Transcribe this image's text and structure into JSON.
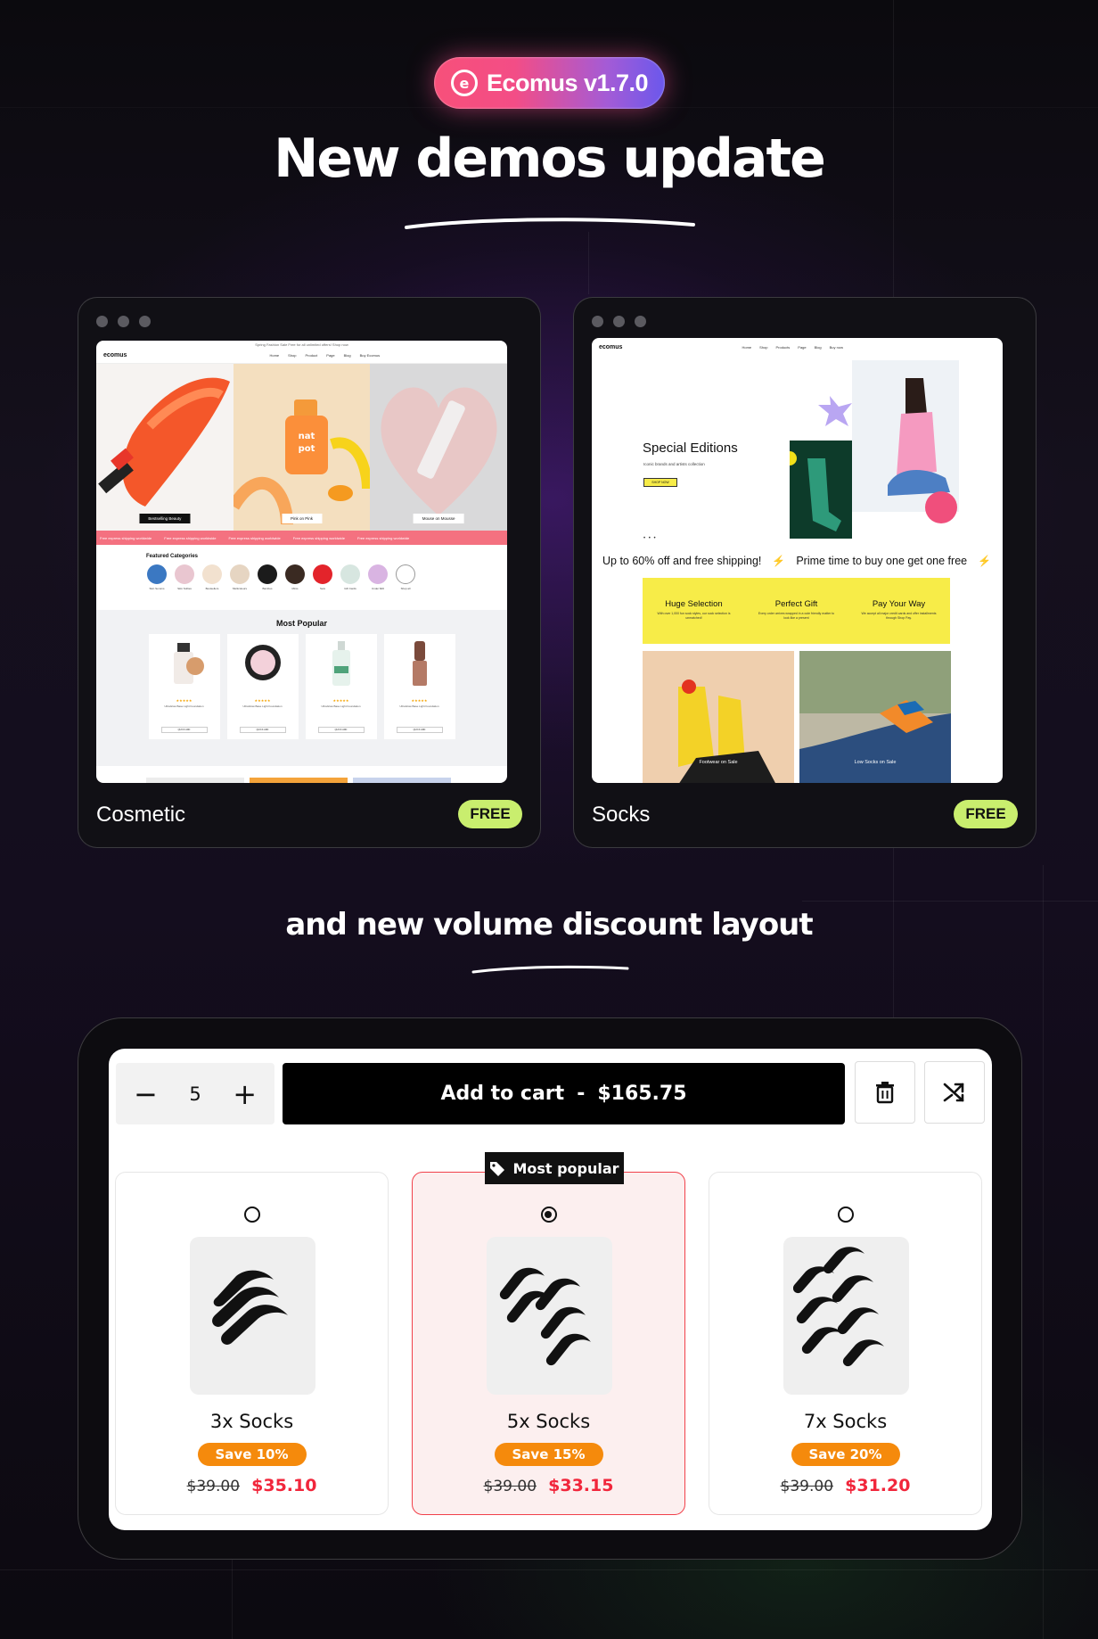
{
  "header": {
    "badge_label": "Ecomus v1.7.0",
    "headline": "New demos update"
  },
  "demos": [
    {
      "name": "Cosmetic",
      "tag": "FREE"
    },
    {
      "name": "Socks",
      "tag": "FREE"
    }
  ],
  "cosmetic_screen": {
    "logo": "ecomus",
    "announcement": "Spring Fashion Sale Free for all unlimited offers! Shop now",
    "menu": [
      "Home",
      "Shop",
      "Product",
      "Page",
      "Blog",
      "Buy Ecomus"
    ],
    "hero_buttons": [
      "Bestselling Beauty",
      "Pink on Pink",
      "Mouse on Mousse"
    ],
    "ticker_items": [
      "Free express shipping worldwide",
      "Free express shipping worldwide",
      "Free express shipping worldwide",
      "Free express shipping worldwide",
      "Free express shipping worldwide"
    ],
    "featured_title": "Featured Categories",
    "categories": [
      "Skin Serums",
      "Skin Softies",
      "Bestsellers",
      "Multicolours",
      "Bambus",
      "Minis",
      "Sets",
      "Gift Cards",
      "Under $40",
      "Shop all"
    ],
    "popular_title": "Most Popular",
    "product_name": "UltraGlow Base Light Foundation",
    "product_stars": "★★★★★",
    "quick_add": "QUICK ADD"
  },
  "socks_screen": {
    "logo": "ecomus",
    "menu": [
      "Home",
      "Shop",
      "Products",
      "Page",
      "Blog",
      "Buy now"
    ],
    "hero_title": "Special Editions",
    "hero_sub": "Iconic brands and artists collection",
    "hero_button": "SHOP NOW",
    "pager": "• • •",
    "ticker": [
      "Up to 60% off and free shipping!",
      "Prime time to buy one get one free"
    ],
    "features": [
      {
        "title": "Huge Selection",
        "text": "With over 1,000 fun sock styles, our sock selection is unmatched!"
      },
      {
        "title": "Perfect Gift",
        "text": "Every order arrives wrapped in a cute friendly matter to look like a present"
      },
      {
        "title": "Pay Your Way",
        "text": "We accept all major credit cards and offer installments through Shop Pay."
      }
    ],
    "photos": [
      {
        "caption": "Footwear on Sale",
        "button": "SHOP NOW"
      },
      {
        "caption": "Low Socks on Sale",
        "button": "SHOP NOW"
      }
    ]
  },
  "volume": {
    "title": "and new volume discount layout",
    "quantity": "5",
    "minus": "−",
    "plus": "+",
    "add_to_cart": "Add to cart",
    "separator": "-",
    "total": "$165.75",
    "popular_label": "Most popular",
    "options": [
      {
        "label": "3x Socks",
        "save": "Save 10%",
        "old_price": "$39.00",
        "new_price": "$35.10",
        "selected": false
      },
      {
        "label": "5x Socks",
        "save": "Save 15%",
        "old_price": "$39.00",
        "new_price": "$33.15",
        "selected": true
      },
      {
        "label": "7x Socks",
        "save": "Save 20%",
        "old_price": "$39.00",
        "new_price": "$31.20",
        "selected": false
      }
    ]
  },
  "colors": {
    "accent_lime": "#c9ee6e",
    "save_orange": "#f58a0c",
    "price_red": "#f1263b",
    "badge_pink": "#f34d86",
    "badge_purple": "#6b58ec"
  },
  "icons": {
    "trash": "trash-icon",
    "shuffle": "shuffle-icon",
    "tag": "tag-icon"
  }
}
